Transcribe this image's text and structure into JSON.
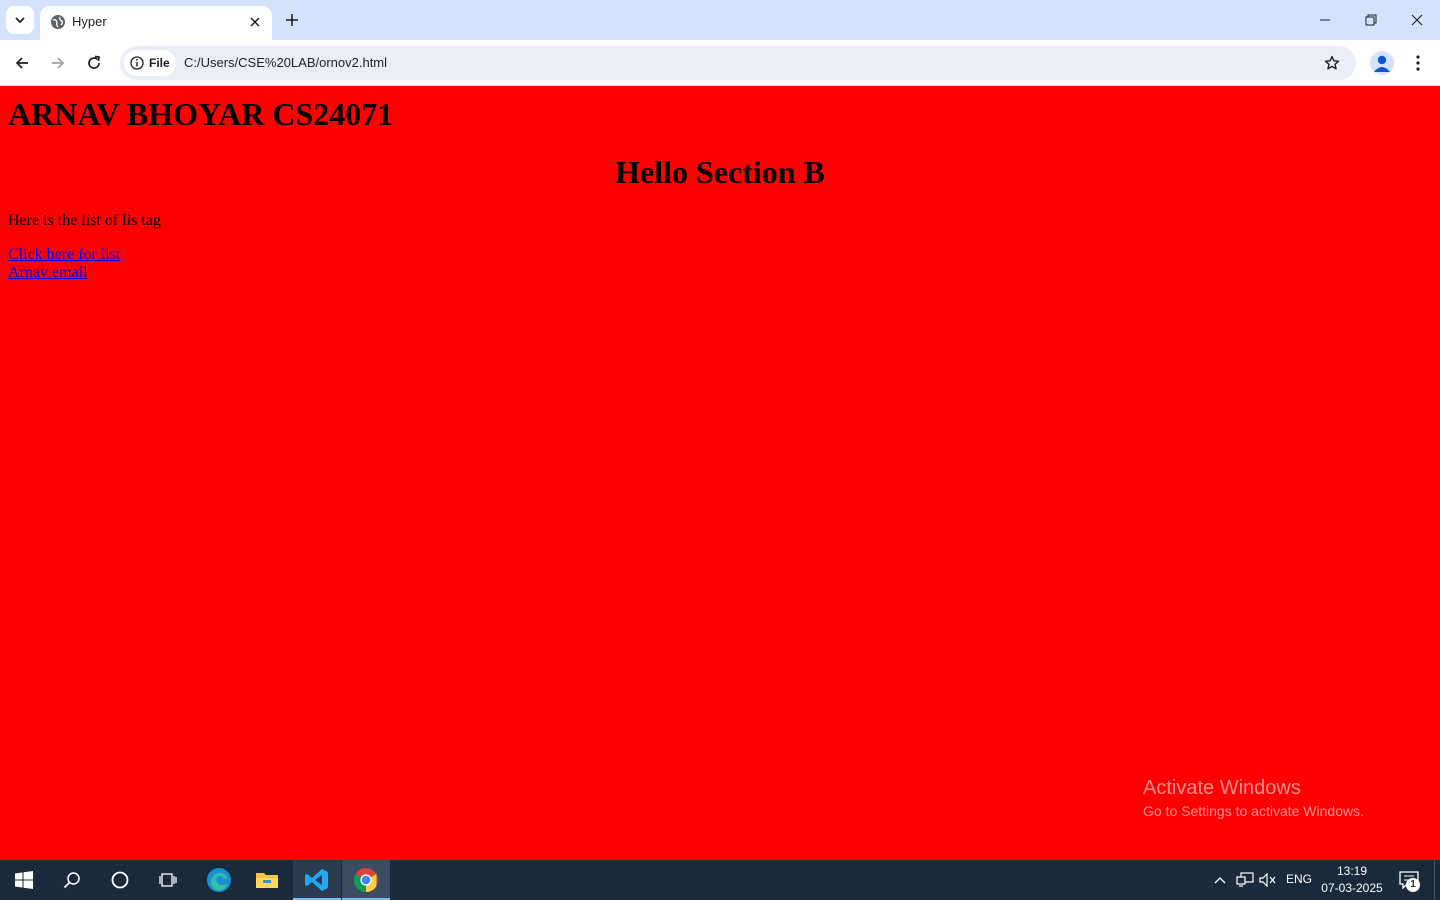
{
  "browser": {
    "tab": {
      "title": "Hyper",
      "favicon_icon": "globe-icon"
    },
    "address_bar": {
      "site_chip_label": "File",
      "url": "C:/Users/CSE%20LAB/ornov2.html"
    }
  },
  "page": {
    "heading_name": "ARNAV BHOYAR CS24071",
    "heading_hello": "Hello Section B",
    "paragraph": "Here is the list of lis tag",
    "links": [
      {
        "label": "Click here for list"
      },
      {
        "label": "Arnav email"
      }
    ],
    "background_color": "#ff0000",
    "link_color": "#0000ee"
  },
  "watermark": {
    "title": "Activate Windows",
    "subtitle": "Go to Settings to activate Windows."
  },
  "taskbar": {
    "language": "ENG",
    "time": "13:19",
    "date": "07-03-2025",
    "notification_count": "1"
  }
}
